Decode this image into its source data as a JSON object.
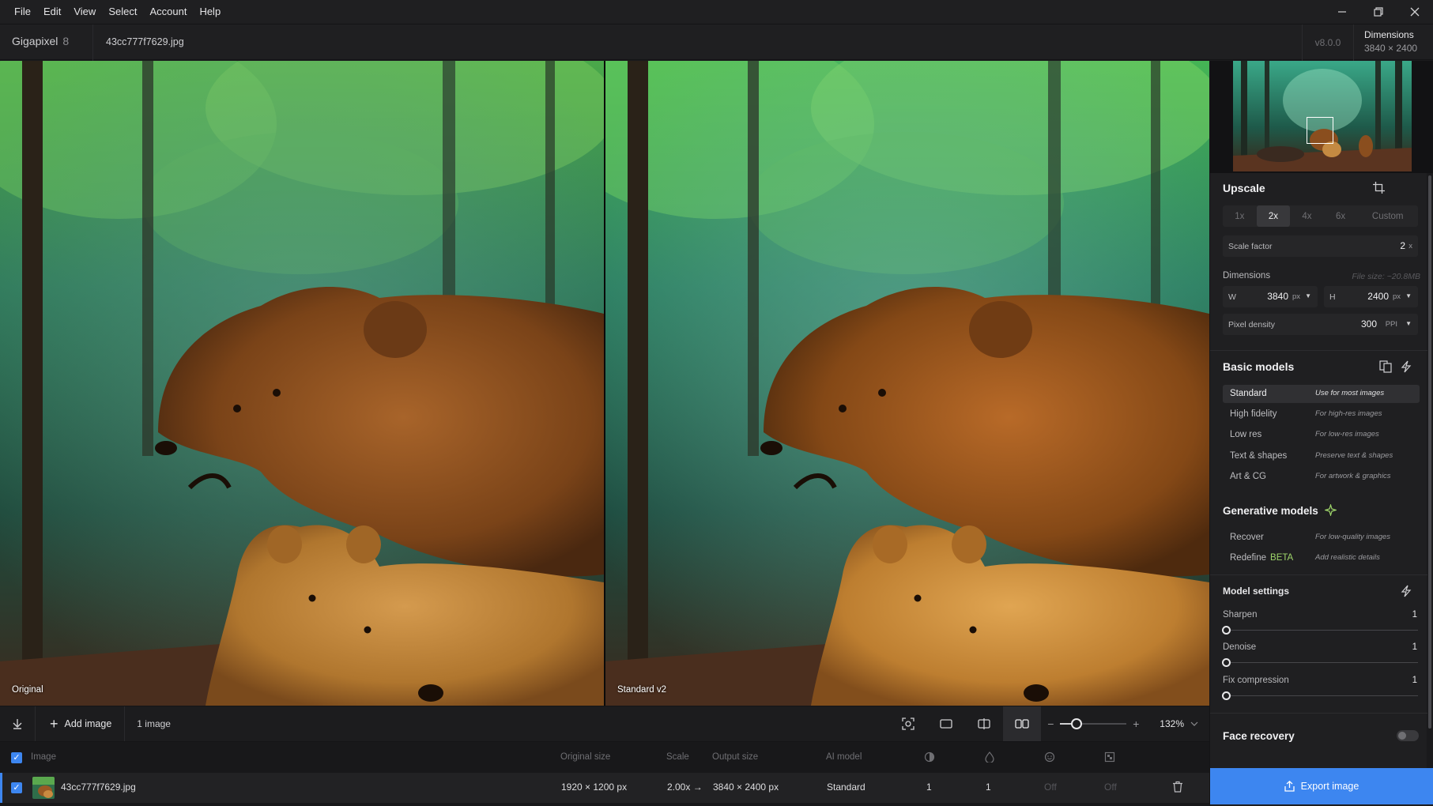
{
  "menu": {
    "items": [
      "File",
      "Edit",
      "View",
      "Select",
      "Account",
      "Help"
    ],
    "window_controls": {
      "minimize": "—",
      "restore": "❐",
      "close": "✕"
    }
  },
  "titlebar": {
    "app_name": "Gigapixel",
    "app_version": "8",
    "file_name": "43cc777f7629.jpg",
    "build_version": "v8.0.0",
    "dimensions_label": "Dimensions",
    "dimensions_value": "3840 × 2400"
  },
  "preview": {
    "left_label": "Original",
    "right_label": "Standard v2"
  },
  "toolbar": {
    "add_image_label": "Add image",
    "image_count": "1 image",
    "zoom_value": "132%",
    "zoom_level": 0.25,
    "icons": [
      "collapse-icon",
      "fit-view-icon",
      "single-view-icon",
      "split-view-icon",
      "side-by-side-icon"
    ]
  },
  "table": {
    "headers": {
      "image": "Image",
      "original_size": "Original size",
      "scale": "Scale",
      "output_size": "Output size",
      "ai_model": "AI model"
    },
    "header_icons": [
      "sharpen-icon",
      "denoise-icon",
      "face-icon",
      "compression-icon"
    ],
    "row": {
      "file": "43cc777f7629.jpg",
      "original_size": "1920 × 1200 px",
      "scale": "2.00x →",
      "output_size": "3840 × 2400 px",
      "ai_model": "Standard",
      "sharpen": "1",
      "denoise": "1",
      "face": "Off",
      "compression": "Off"
    }
  },
  "panel": {
    "upscale": {
      "title": "Upscale",
      "tabs": [
        "1x",
        "2x",
        "4x",
        "6x",
        "Custom"
      ],
      "active_tab": "2x",
      "scale_factor_label": "Scale factor",
      "scale_factor_value": "2",
      "scale_factor_unit": "x",
      "dimensions_label": "Dimensions",
      "file_size": "File size: ~20.8MB",
      "width_label": "W",
      "width_value": "3840",
      "height_label": "H",
      "height_value": "2400",
      "px_unit": "px",
      "pixel_density_label": "Pixel density",
      "pixel_density_value": "300",
      "ppi_unit": "PPI"
    },
    "basic_models": {
      "title": "Basic models",
      "items": [
        {
          "name": "Standard",
          "desc": "Use for most images"
        },
        {
          "name": "High fidelity",
          "desc": "For high-res images"
        },
        {
          "name": "Low res",
          "desc": "For low-res images"
        },
        {
          "name": "Text & shapes",
          "desc": "Preserve text & shapes"
        },
        {
          "name": "Art & CG",
          "desc": "For artwork & graphics"
        }
      ],
      "active": "Standard"
    },
    "generative_models": {
      "title": "Generative models",
      "items": [
        {
          "name": "Recover",
          "desc": "For low-quality images"
        },
        {
          "name": "Redefine",
          "badge": "BETA",
          "desc": "Add realistic details"
        }
      ]
    },
    "model_settings": {
      "title": "Model settings",
      "sharpen_label": "Sharpen",
      "sharpen_value": "1",
      "denoise_label": "Denoise",
      "denoise_value": "1",
      "fix_compression_label": "Fix compression",
      "fix_compression_value": "1"
    },
    "face_recovery": {
      "title": "Face recovery",
      "enabled": false
    },
    "export_label": "Export image"
  },
  "colors": {
    "accent": "#3d86f0",
    "beta": "#9fd66a",
    "background": "#1b1b1d"
  }
}
